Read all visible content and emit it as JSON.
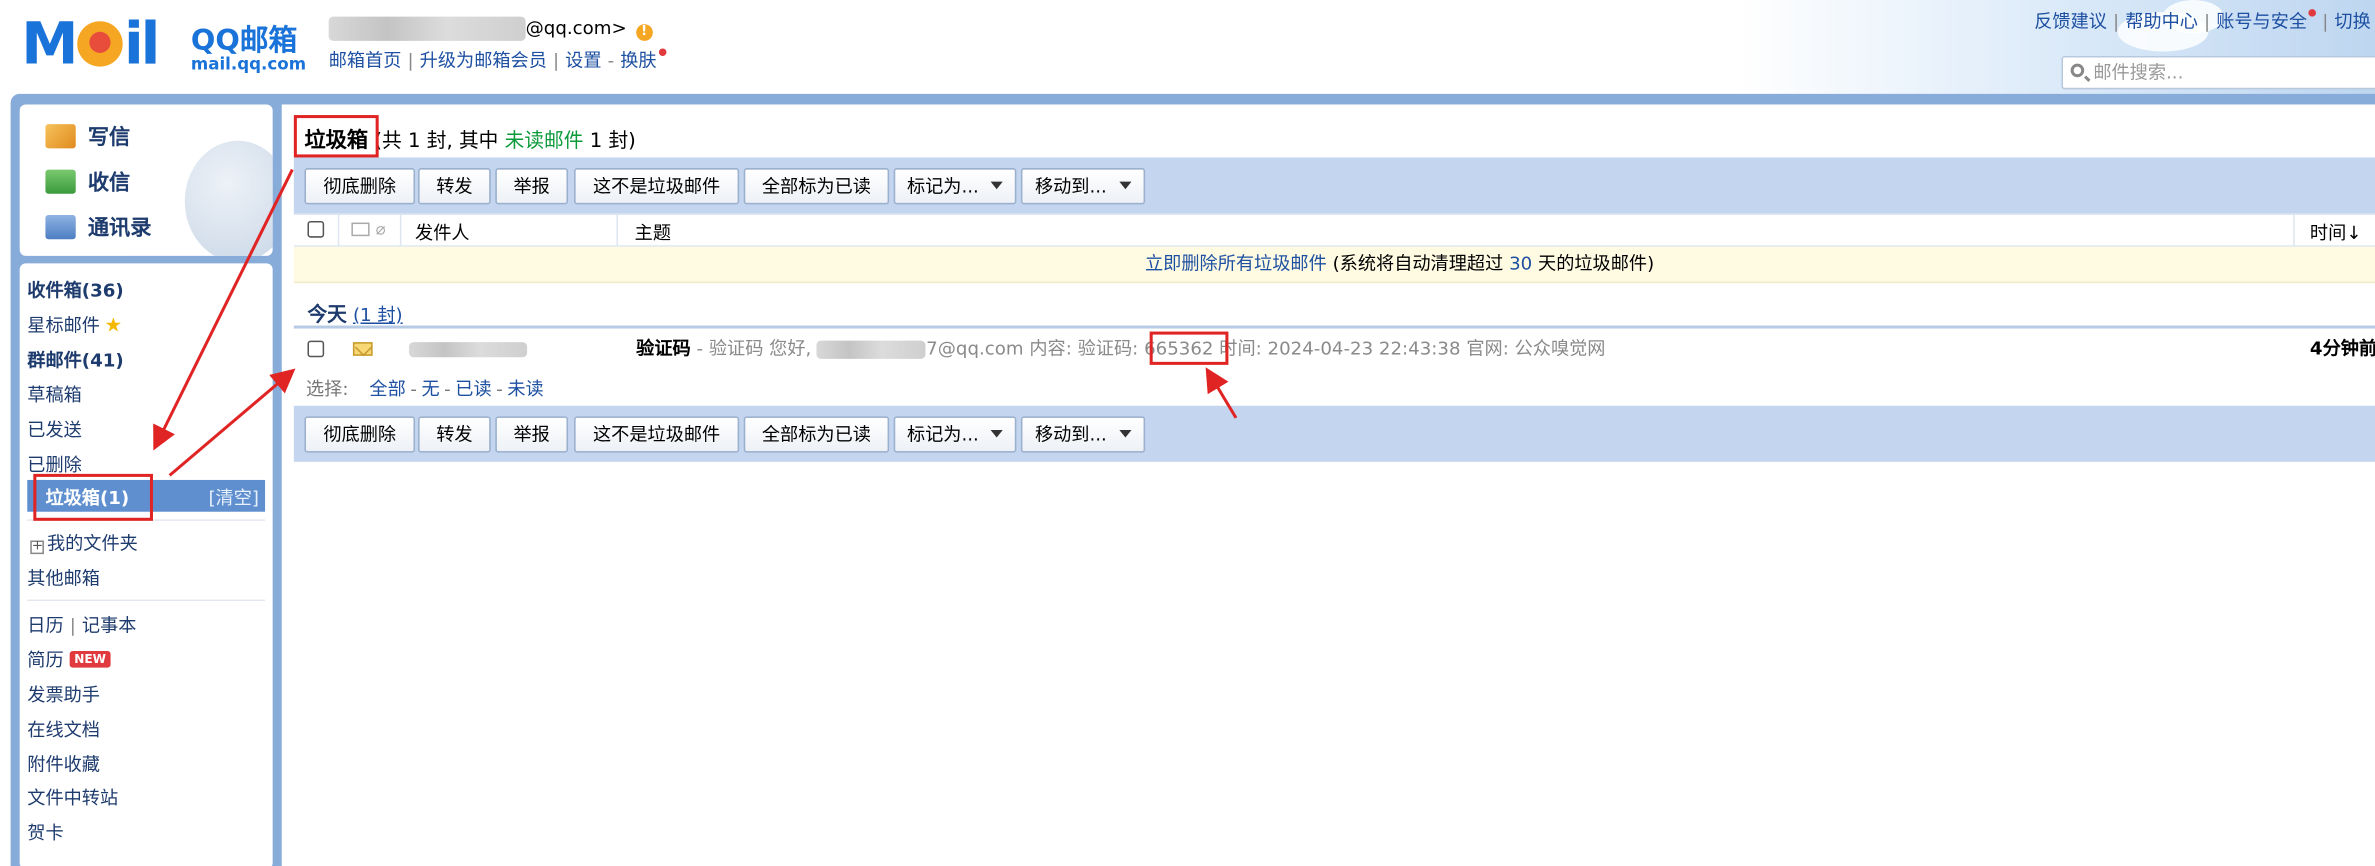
{
  "app": {
    "logo_mail": "MAIL",
    "logo_title": "QQ邮箱",
    "logo_url": "mail.qq.com",
    "account_suffix": "@qq.com>",
    "account_warning": "!"
  },
  "header_links": [
    "邮箱首页",
    "升级为邮箱会员",
    "设置",
    "换肤"
  ],
  "top_links": [
    "反馈建议",
    "帮助中心",
    "账号与安全",
    "切换"
  ],
  "search": {
    "placeholder": "邮件搜索..."
  },
  "quick_actions": [
    "写信",
    "收信",
    "通讯录"
  ],
  "folders": {
    "inbox": "收件箱(36)",
    "starred": "星标邮件",
    "group": "群邮件(41)",
    "drafts": "草稿箱",
    "sent": "已发送",
    "deleted": "已删除",
    "spam": "垃圾箱(1)",
    "spam_clear": "[清空]",
    "my_folders": "我的文件夹",
    "other_mailboxes": "其他邮箱",
    "calendar": "日历",
    "notes": "记事本",
    "resume": "简历",
    "resume_badge": "NEW",
    "invoice": "发票助手",
    "docs": "在线文档",
    "attachments": "附件收藏",
    "transfer": "文件中转站",
    "cards": "贺卡"
  },
  "main": {
    "folder_title": "垃圾箱",
    "summary_prefix": "(共 1 封, 其中",
    "summary_unread": "未读邮件",
    "summary_suffix": "1 封)",
    "toolbar": {
      "delete": "彻底删除",
      "forward": "转发",
      "report": "举报",
      "not_spam": "这不是垃圾邮件",
      "mark_all_read": "全部标为已读",
      "mark_as": "标记为...",
      "move_to": "移动到..."
    },
    "columns": {
      "sender": "发件人",
      "subject": "主题",
      "time": "时间↓"
    },
    "notice": {
      "link": "立即删除所有垃圾邮件",
      "text_a": "(系统将自动清理超过",
      "days": "30",
      "text_b": "天的垃圾邮件)"
    },
    "group": {
      "label": "今天",
      "count": "(1 封)"
    },
    "mail": {
      "subject": "验证码",
      "preview_a": "- 验证码 您好,",
      "preview_b": "7@qq.com 内容: 验证码:",
      "code": "665362",
      "preview_c": "时间: 2024-04-23 22:43:38 官网: 公众嗅觉网",
      "time": "4分钟前"
    },
    "select": {
      "label": "选择:",
      "all": "全部",
      "none": "无",
      "read": "已读",
      "unread": "未读"
    }
  },
  "colors": {
    "accent": "#1e50a2",
    "frame": "#88acd9",
    "toolbar": "#c3d5ef",
    "selected": "#5f8fcf",
    "annotation": "#e02424"
  }
}
